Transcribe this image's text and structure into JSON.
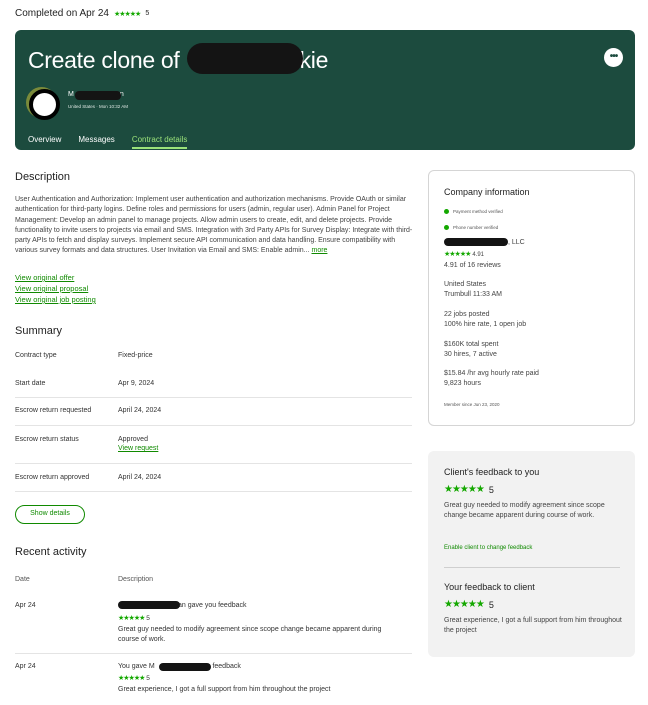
{
  "status": {
    "text": "Completed on Apr 24",
    "stars": "★★★★★",
    "rating": "5"
  },
  "hero": {
    "title_prefix": "Create clone of",
    "title_suffix": "kie",
    "more_icon": "•••",
    "user_first": "M",
    "user_last": "n",
    "location": "United States · Mon 10:32 AM",
    "tabs": [
      "Overview",
      "Messages",
      "Contract details"
    ]
  },
  "description": {
    "heading": "Description",
    "body": "User Authentication and Authorization: Implement user authentication and authorization mechanisms. Provide OAuth or similar authentication for third-party logins. Define roles and permissions for users (admin, regular user). Admin Panel for Project Management: Develop an admin panel to manage projects. Allow admin users to create, edit, and delete projects. Provide functionality to invite users to projects via email and SMS. Integration with 3rd Party APIs for Survey Display: Integrate with third-party APIs to fetch and display surveys. Implement secure API communication and data handling. Ensure compatibility with various survey formats and data structures. User Invitation via Email and SMS: Enable admin...",
    "more": "more",
    "links": [
      "View original offer",
      "View original proposal",
      "View original job posting"
    ]
  },
  "summary": {
    "heading": "Summary",
    "rows": [
      {
        "label": "Contract type",
        "value": "Fixed-price"
      },
      {
        "label": "Start date",
        "value": "Apr 9, 2024"
      },
      {
        "label": "Escrow return requested",
        "value": "April 24, 2024"
      },
      {
        "label": "Escrow return status",
        "value": "Approved",
        "link": "View request"
      },
      {
        "label": "Escrow return approved",
        "value": "April 24, 2024"
      }
    ],
    "show_details": "Show details"
  },
  "activity": {
    "heading": "Recent activity",
    "col_date": "Date",
    "col_desc": "Description",
    "rows": [
      {
        "date": "Apr 24",
        "title_prefix": "",
        "title_suffix": "an gave you feedback",
        "stars": "★★★★★",
        "rating": "5",
        "comment": "Great guy needed to modify agreement since scope change became apparent during course of work."
      },
      {
        "date": "Apr 24",
        "title_prefix": "You gave M",
        "title_suffix": "an feedback",
        "stars": "★★★★★",
        "rating": "5",
        "comment": "Great experience, I got a full support from him throughout the project"
      }
    ]
  },
  "company": {
    "heading": "Company information",
    "verified_payment": "Payment method verified",
    "verified_phone": "Phone number verified",
    "name_suffix": ", LLC",
    "stars": "★★★★★",
    "rating": "4.91",
    "reviews": "4.91 of 16 reviews",
    "country": "United States",
    "city_time": "Trumbull 11:33 AM",
    "jobs": "22 jobs posted",
    "hire": "100% hire rate, 1 open job",
    "spent": "$160K total spent",
    "hires": "30 hires, 7 active",
    "rate": "$15.84 /hr avg hourly rate paid",
    "hours": "9,823 hours",
    "member": "Member since Jun 23, 2020"
  },
  "feedback": {
    "client_heading": "Client's feedback to you",
    "client_stars": "★★★★★",
    "client_rating": "5",
    "client_comment": "Great guy needed to modify agreement since scope change became apparent during course of work.",
    "enable_link": "Enable client to change feedback",
    "your_heading": "Your feedback to client",
    "your_stars": "★★★★★",
    "your_rating": "5",
    "your_comment": "Great experience, I got a full support from him throughout the project"
  },
  "colors": {
    "hero_bg": "#1c4b3e",
    "accent": "#14a800",
    "link": "#108a00",
    "tab_active": "#9be37a"
  }
}
